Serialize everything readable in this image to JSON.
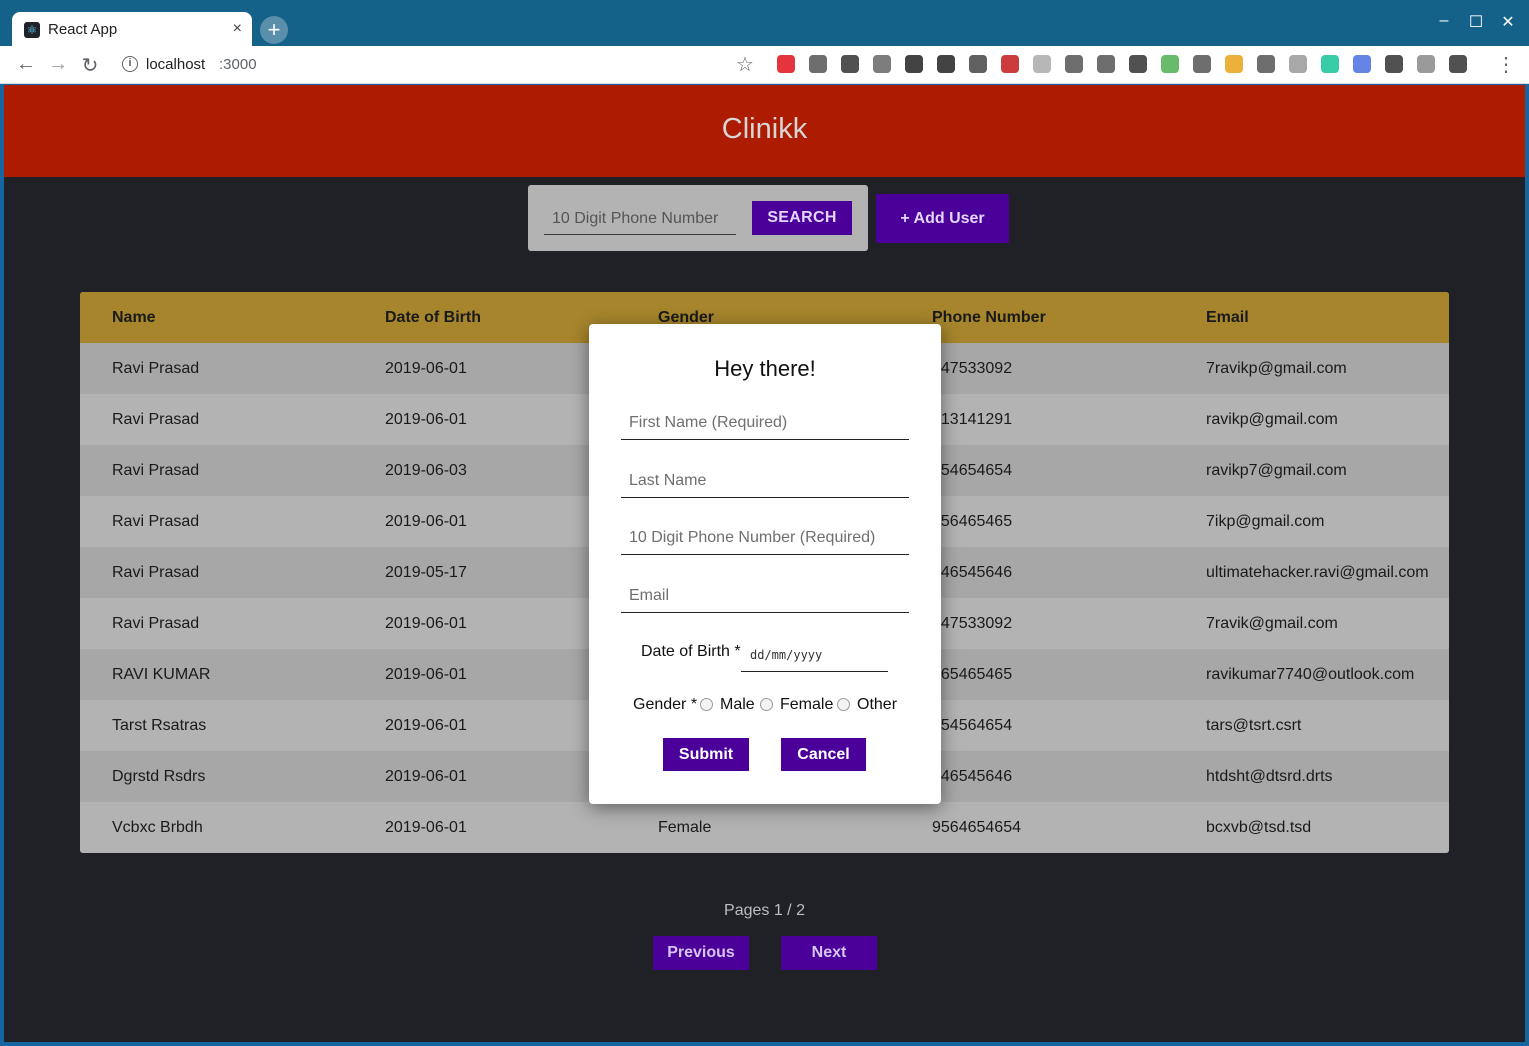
{
  "browser": {
    "tab_title": "React App",
    "tab_favicon": "react-icon",
    "tab_close": "×",
    "new_tab": "+",
    "url_host": "localhost",
    "url_port": ":3000",
    "window_controls": [
      "–",
      "☐",
      "✕"
    ],
    "extension_icons": [
      "opera-icon",
      "eyedropper-icon",
      "download-icon",
      "extension-icon",
      "extension-icon",
      "extension-icon",
      "extension-icon",
      "extension-icon",
      "extension-icon",
      "extension-icon",
      "s-icon",
      "screenshot-icon",
      "node-icon",
      "chrome-icon",
      "low-badge-icon",
      "pocket-icon",
      "extension-icon",
      "grammarly-icon",
      "translate-icon",
      "s-icon",
      "extension-icon",
      "profile-icon"
    ]
  },
  "app": {
    "title": "Clinikk",
    "header_color": "#ad1c00",
    "accent_color": "#4a0099"
  },
  "search": {
    "placeholder": "10 Digit Phone Number",
    "button_label": "SEARCH"
  },
  "add_user_label": "+ Add User",
  "table": {
    "columns": [
      "Name",
      "Date of Birth",
      "Gender",
      "Phone Number",
      "Email"
    ],
    "rows": [
      {
        "name": "Ravi Prasad",
        "dob": "2019-06-01",
        "gender": "",
        "phone": "447533092",
        "email": "7ravikp@gmail.com"
      },
      {
        "name": "Ravi Prasad",
        "dob": "2019-06-01",
        "gender": "",
        "phone": "313141291",
        "email": "ravikp@gmail.com"
      },
      {
        "name": "Ravi Prasad",
        "dob": "2019-06-03",
        "gender": "",
        "phone": "454654654",
        "email": "ravikp7@gmail.com"
      },
      {
        "name": "Ravi Prasad",
        "dob": "2019-06-01",
        "gender": "",
        "phone": "456465465",
        "email": "7ikp@gmail.com"
      },
      {
        "name": "Ravi Prasad",
        "dob": "2019-05-17",
        "gender": "",
        "phone": "546545646",
        "email": "ultimatehacker.ravi@gmail.com"
      },
      {
        "name": "Ravi Prasad",
        "dob": "2019-06-01",
        "gender": "",
        "phone": "447533092",
        "email": "7ravik@gmail.com"
      },
      {
        "name": "RAVI KUMAR",
        "dob": "2019-06-01",
        "gender": "",
        "phone": "465465465",
        "email": "ravikumar7740@outlook.com"
      },
      {
        "name": "Tarst Rsatras",
        "dob": "2019-06-01",
        "gender": "",
        "phone": "654564654",
        "email": "tars@tsrt.csrt"
      },
      {
        "name": "Dgrstd Rsdrs",
        "dob": "2019-06-01",
        "gender": "",
        "phone": "546545646",
        "email": "htdsht@dtsrd.drts"
      },
      {
        "name": "Vcbxc Brbdh",
        "dob": "2019-06-01",
        "gender": "Female",
        "phone": "9564654654",
        "email": "bcxvb@tsd.tsd"
      }
    ]
  },
  "pagination": {
    "label": "Pages 1 / 2",
    "previous": "Previous",
    "next": "Next"
  },
  "modal": {
    "title": "Hey there!",
    "first_name_placeholder": "First Name (Required)",
    "last_name_placeholder": "Last Name",
    "phone_placeholder": "10 Digit Phone Number (Required)",
    "email_placeholder": "Email",
    "dob_label": "Date of Birth *",
    "dob_placeholder": "dd/mm/yyyy",
    "gender_label": "Gender *",
    "gender_options": [
      "Male",
      "Female",
      "Other"
    ],
    "submit_label": "Submit",
    "cancel_label": "Cancel"
  }
}
